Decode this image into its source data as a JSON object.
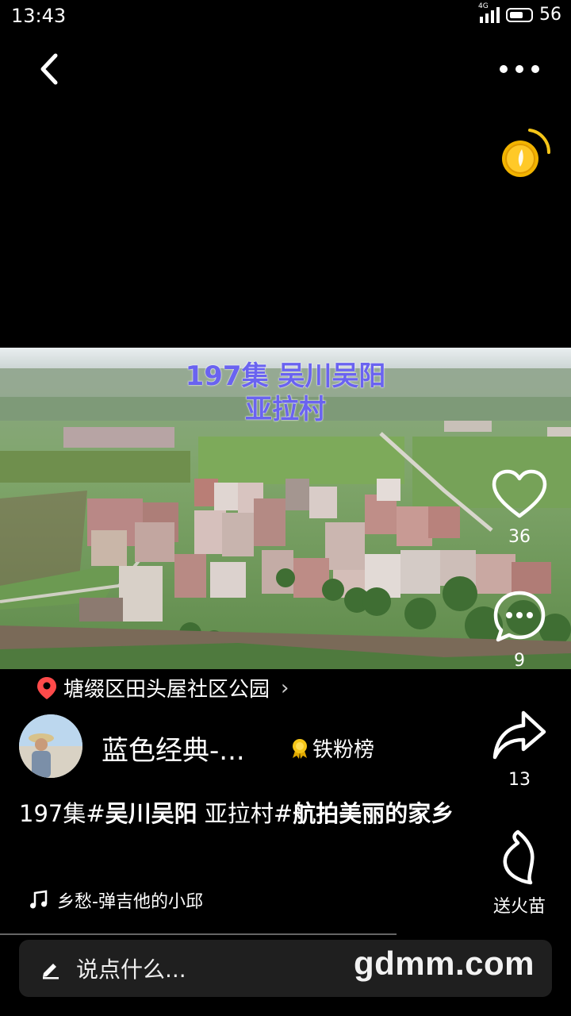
{
  "status": {
    "time": "13:43",
    "network": "4G",
    "battery": "56"
  },
  "video": {
    "caption_line1": "197集 吴川吴阳",
    "caption_line2": "亚拉村"
  },
  "actions": {
    "like_count": "36",
    "comment_count": "9",
    "share_count": "13",
    "gift_label": "送火苗"
  },
  "location": {
    "text": "塘缀区田头屋社区公园"
  },
  "author": {
    "name": "蓝色经典-...",
    "badge_label": "铁粉榜"
  },
  "description": {
    "part1": "197集#",
    "part2": "吴川吴阳",
    "part3": "  亚拉村#",
    "part4": "航拍美丽的家乡"
  },
  "music": {
    "title": "乡愁-弹吉他的小邱"
  },
  "comment": {
    "placeholder": "说点什么..."
  },
  "watermark": "gdmm.com",
  "icons": [
    "back-icon",
    "more-icon",
    "coin-icon",
    "heart-icon",
    "comment-icon",
    "share-icon",
    "flame-icon",
    "location-pin-icon",
    "medal-icon",
    "music-note-icon",
    "pen-icon"
  ]
}
